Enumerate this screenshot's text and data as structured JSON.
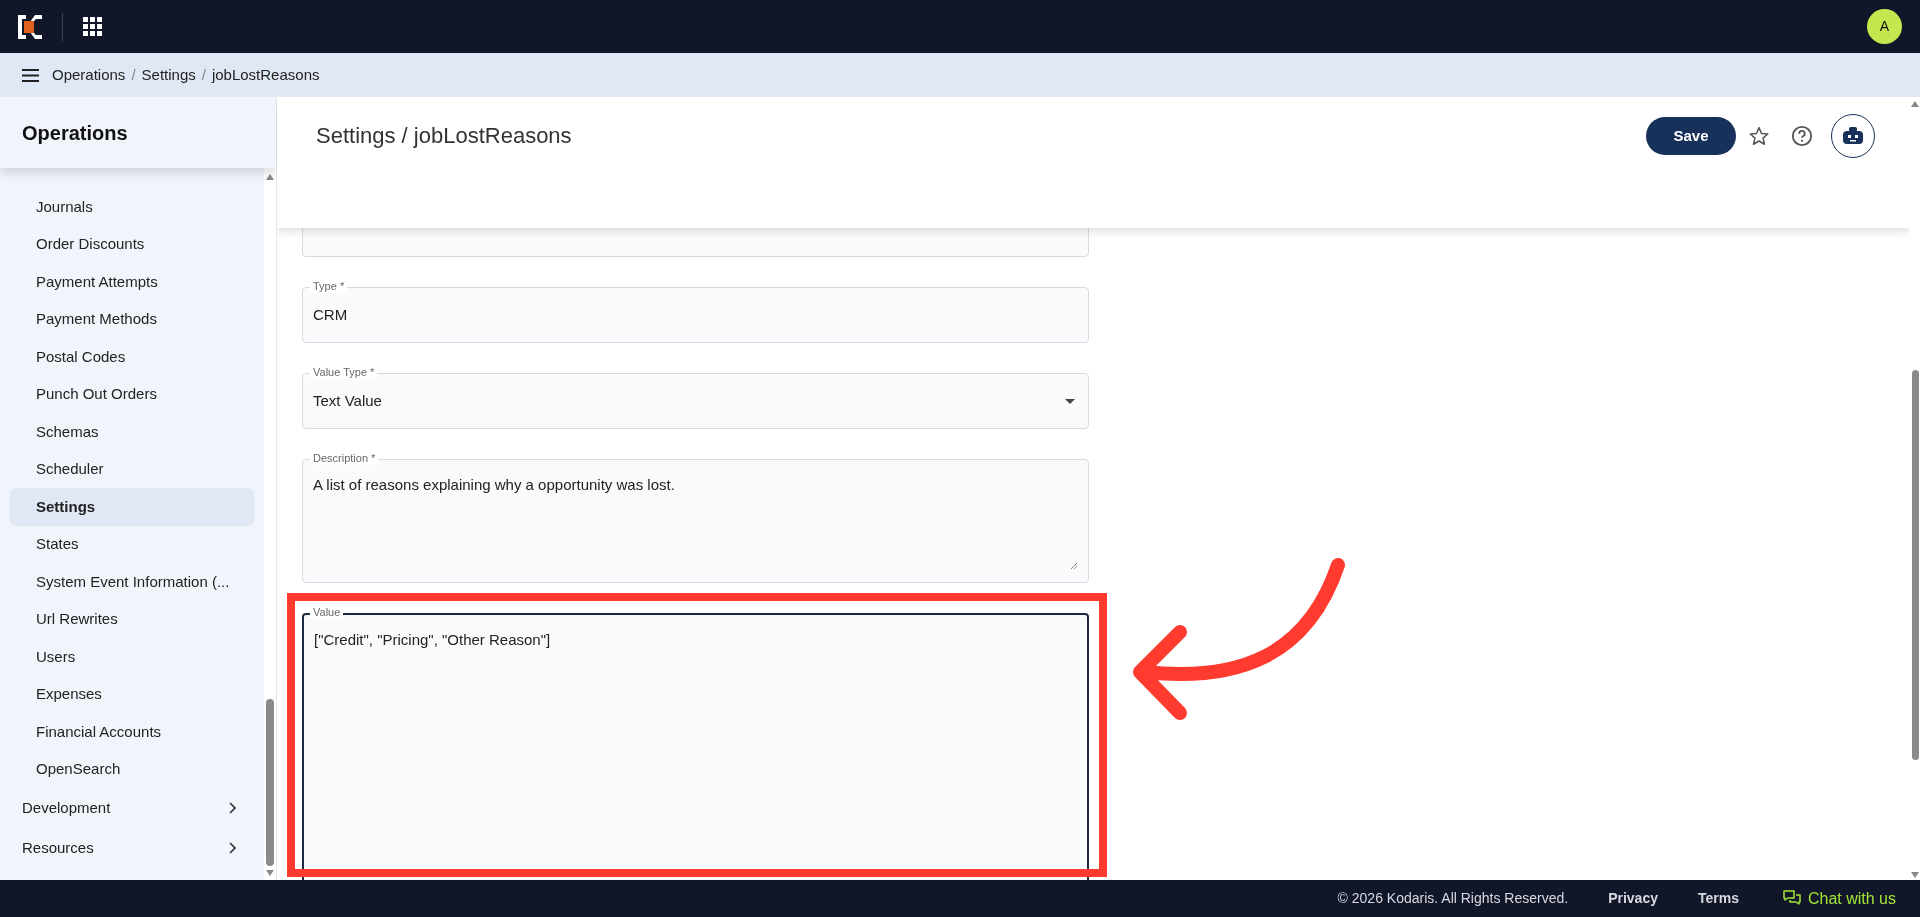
{
  "topbar": {
    "avatar": "A"
  },
  "breadcrumbs": {
    "separator": "/",
    "items": [
      "Operations",
      "Settings",
      "jobLostReasons"
    ]
  },
  "sidebar": {
    "title": "Operations",
    "items": [
      {
        "label": "Journals",
        "selected": false
      },
      {
        "label": "Order Discounts",
        "selected": false
      },
      {
        "label": "Payment Attempts",
        "selected": false
      },
      {
        "label": "Payment Methods",
        "selected": false
      },
      {
        "label": "Postal Codes",
        "selected": false
      },
      {
        "label": "Punch Out Orders",
        "selected": false
      },
      {
        "label": "Schemas",
        "selected": false
      },
      {
        "label": "Scheduler",
        "selected": false
      },
      {
        "label": "Settings",
        "selected": true
      },
      {
        "label": "States",
        "selected": false
      },
      {
        "label": "System Event Information (...",
        "selected": false
      },
      {
        "label": "Url Rewrites",
        "selected": false
      },
      {
        "label": "Users",
        "selected": false
      },
      {
        "label": "Expenses",
        "selected": false
      },
      {
        "label": "Financial Accounts",
        "selected": false
      },
      {
        "label": "OpenSearch",
        "selected": false
      }
    ],
    "groups": [
      {
        "label": "Development"
      },
      {
        "label": "Resources"
      }
    ]
  },
  "page": {
    "title": "Settings / jobLostReasons",
    "save": "Save"
  },
  "form": [
    {
      "kind": "input",
      "focused": false
    },
    {
      "kind": "input",
      "label": "Type *",
      "value": "CRM",
      "focused": false
    },
    {
      "kind": "select",
      "label": "Value Type *",
      "value": "Text Value",
      "focused": false
    },
    {
      "kind": "textarea",
      "label": "Description *",
      "value": "A list of reasons explaining why a opportunity was lost.",
      "focused": false
    },
    {
      "kind": "textarea",
      "label": "Value",
      "value": "[\"Credit\", \"Pricing\", \"Other Reason\"]",
      "focused": true
    }
  ],
  "footer": {
    "copyright": "© 2026 Kodaris. All Rights Reserved.",
    "links": [
      "Privacy",
      "Terms"
    ],
    "chat": "Chat with us"
  }
}
